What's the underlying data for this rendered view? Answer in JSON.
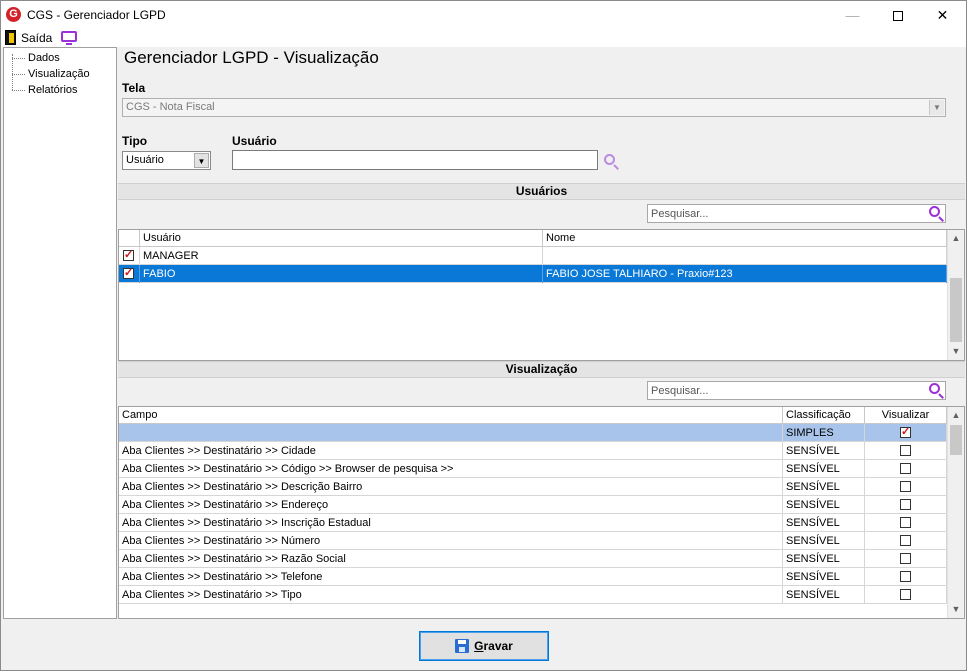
{
  "window": {
    "title": "CGS - Gerenciador LGPD",
    "logo_letter": "G",
    "minimize_glyph": "—",
    "close_glyph": "✕"
  },
  "toolbar": {
    "exit_label": "Saída",
    "icons": [
      "exit-door-icon",
      "monitor-icon"
    ]
  },
  "nav": {
    "items": [
      {
        "label": "Dados"
      },
      {
        "label": "Visualização"
      },
      {
        "label": "Relatórios"
      }
    ]
  },
  "main": {
    "heading": "Gerenciador LGPD - Visualização",
    "tela": {
      "label": "Tela",
      "value": "CGS - Nota Fiscal"
    },
    "tipo": {
      "label": "Tipo",
      "value": "Usuário"
    },
    "usuario": {
      "label": "Usuário",
      "value": ""
    }
  },
  "users_section": {
    "title": "Usuários",
    "search_placeholder": "Pesquisar...",
    "columns": [
      "Usuário",
      "Nome"
    ],
    "rows": [
      {
        "checked": true,
        "user": "MANAGER",
        "name": "",
        "selected": false
      },
      {
        "checked": true,
        "user": "FABIO",
        "name": "FABIO JOSE TALHIARO - Praxio#123",
        "selected": true
      }
    ]
  },
  "view_section": {
    "title": "Visualização",
    "search_placeholder": "Pesquisar...",
    "columns": [
      "Campo",
      "Classificação",
      "Visualizar"
    ],
    "rows": [
      {
        "campo": "",
        "classificacao": "SIMPLES",
        "visualizar": true
      },
      {
        "campo": "Aba Clientes >> Destinatário >> Cidade",
        "classificacao": "SENSÍVEL",
        "visualizar": false
      },
      {
        "campo": "Aba Clientes >> Destinatário >> Código >> Browser de pesquisa >>",
        "classificacao": "SENSÍVEL",
        "visualizar": false
      },
      {
        "campo": "Aba Clientes >> Destinatário >> Descrição Bairro",
        "classificacao": "SENSÍVEL",
        "visualizar": false
      },
      {
        "campo": "Aba Clientes >> Destinatário >> Endereço",
        "classificacao": "SENSÍVEL",
        "visualizar": false
      },
      {
        "campo": "Aba Clientes >> Destinatário >> Inscrição Estadual",
        "classificacao": "SENSÍVEL",
        "visualizar": false
      },
      {
        "campo": "Aba Clientes >> Destinatário >> Número",
        "classificacao": "SENSÍVEL",
        "visualizar": false
      },
      {
        "campo": "Aba Clientes >> Destinatário >> Razão Social",
        "classificacao": "SENSÍVEL",
        "visualizar": false
      },
      {
        "campo": "Aba Clientes >> Destinatário >> Telefone",
        "classificacao": "SENSÍVEL",
        "visualizar": false
      },
      {
        "campo": "Aba Clientes >> Destinatário >> Tipo",
        "classificacao": "SENSÍVEL",
        "visualizar": false
      }
    ]
  },
  "footer": {
    "save_first_letter": "G",
    "save_rest": "ravar"
  },
  "colors": {
    "selection": "#0a78d7",
    "pale_selection": "#a9c4ea",
    "accent_purple": "#9b30d9",
    "logo_red": "#d2232a"
  }
}
